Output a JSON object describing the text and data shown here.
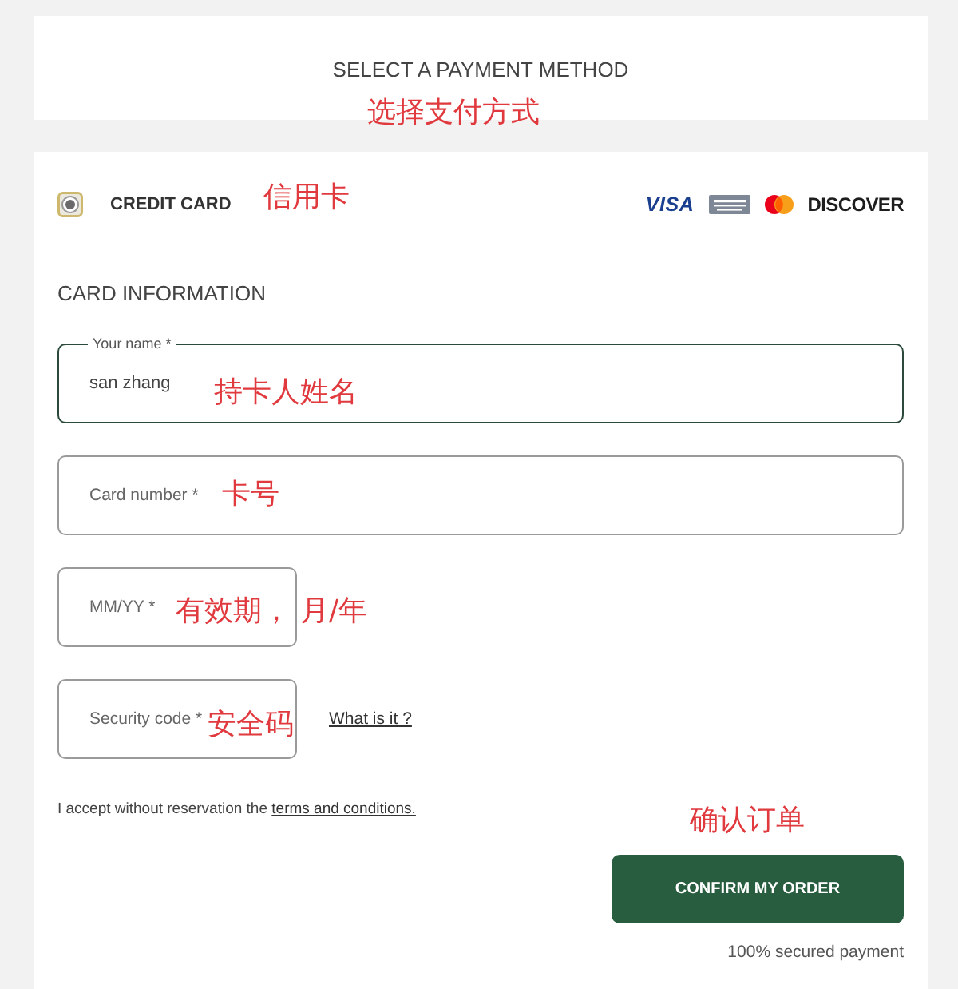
{
  "header": {
    "title": "SELECT A PAYMENT METHOD",
    "annotation": "选择支付方式"
  },
  "payment_option": {
    "label": "CREDIT CARD",
    "selected": true,
    "annotation": "信用卡",
    "card_brands": [
      {
        "kind": "visa",
        "label": "VISA"
      },
      {
        "kind": "amex"
      },
      {
        "kind": "mastercard"
      },
      {
        "kind": "discover",
        "label": "DISCOVER"
      }
    ]
  },
  "card_information": {
    "title": "CARD INFORMATION",
    "fields": [
      {
        "kind": "name",
        "label": "Your name *",
        "value": "san zhang",
        "focused": true,
        "annotations": [
          "持卡人姓名"
        ]
      },
      {
        "kind": "card_number",
        "placeholder": "Card number *",
        "focused": false,
        "annotations": [
          "卡号"
        ]
      },
      {
        "kind": "expiry",
        "placeholder": "MM/YY *",
        "focused": false,
        "annotations": [
          "有效期，",
          "月/年"
        ]
      },
      {
        "kind": "cvc",
        "placeholder": "Security code *",
        "focused": false,
        "annotations": [
          "安全码"
        ],
        "help_link": "What is it ?"
      }
    ]
  },
  "terms": {
    "text": "I accept without reservation the",
    "link": "terms and conditions."
  },
  "order": {
    "annotation": "确认订单",
    "button": "CONFIRM MY ORDER",
    "note": "100% secured payment"
  }
}
